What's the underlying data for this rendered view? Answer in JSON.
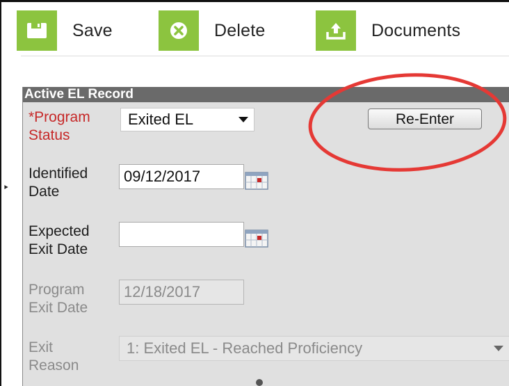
{
  "toolbar": {
    "save_label": "Save",
    "delete_label": "Delete",
    "documents_label": "Documents",
    "accent_color": "#8cc43f"
  },
  "panel": {
    "title": "Active EL Record"
  },
  "form": {
    "program_status": {
      "label_line1": "*Program",
      "label_line2": "Status",
      "value": "Exited EL"
    },
    "reenter_button": "Re-Enter",
    "identified_date": {
      "label_line1": "Identified",
      "label_line2": "Date",
      "value": "09/12/2017"
    },
    "expected_exit_date": {
      "label_line1": "Expected",
      "label_line2": "Exit Date",
      "value": ""
    },
    "program_exit_date": {
      "label_line1": "Program",
      "label_line2": "Exit Date",
      "value": "12/18/2017"
    },
    "exit_reason": {
      "label_line1": "Exit",
      "label_line2": "Reason",
      "value": "1: Exited EL - Reached Proficiency"
    }
  },
  "colors": {
    "required_label": "#c62828",
    "highlight_circle": "#e53935",
    "panel_header": "#6a6a6a"
  },
  "icons": [
    "save-icon",
    "delete-icon",
    "upload-icon",
    "calendar-icon"
  ]
}
